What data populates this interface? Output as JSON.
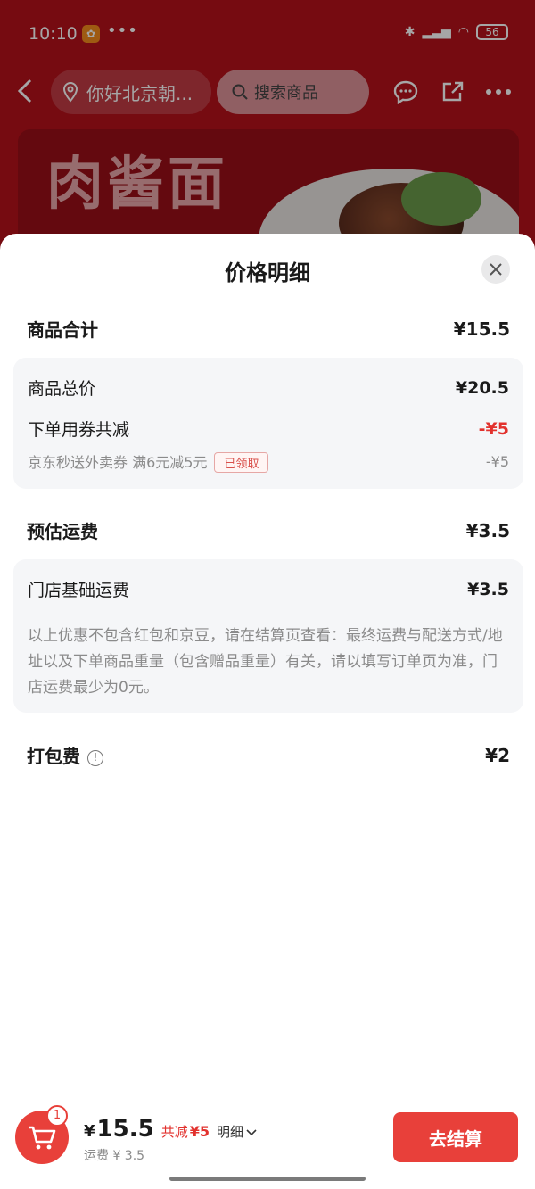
{
  "status_bar": {
    "time": "10:10",
    "battery": "56"
  },
  "header": {
    "location": "你好北京朝...",
    "search_placeholder": "搜索商品"
  },
  "banner": {
    "text": "肉酱面"
  },
  "sheet": {
    "title": "价格明细",
    "goods_total": {
      "label": "商品合计",
      "value": "¥15.5"
    },
    "goods_box": {
      "total_price_label": "商品总价",
      "total_price_value": "¥20.5",
      "coupon_label": "下单用券共减",
      "coupon_value": "-¥5",
      "coupon_name": "京东秒送外卖券 满6元减5元",
      "coupon_tag": "已领取",
      "coupon_sub_value": "-¥5"
    },
    "shipping": {
      "label": "预估运费",
      "value": "¥3.5"
    },
    "shipping_box": {
      "base_label": "门店基础运费",
      "base_value": "¥3.5",
      "note": "以上优惠不包含红包和京豆，请在结算页查看：最终运费与配送方式/地址以及下单商品重量（包含赠品重量）有关，请以填写订单页为准，门店运费最少为0元。"
    },
    "packing": {
      "label": "打包费",
      "value": "¥2"
    }
  },
  "bottom_bar": {
    "cart_count": "1",
    "currency": "¥",
    "price": "15.5",
    "discount_label": "共减",
    "discount_value": "¥5",
    "detail_label": "明细",
    "shipping": "运费 ¥ 3.5",
    "checkout_label": "去结算"
  },
  "colors": {
    "accent": "#e8403a",
    "discount_red": "#e2312d",
    "header_bg": "#b5111b"
  },
  "icons": [
    "back-icon",
    "location-icon",
    "search-icon",
    "message-icon",
    "share-icon",
    "more-icon",
    "close-icon",
    "info-icon",
    "cart-icon",
    "chevron-down-icon"
  ]
}
